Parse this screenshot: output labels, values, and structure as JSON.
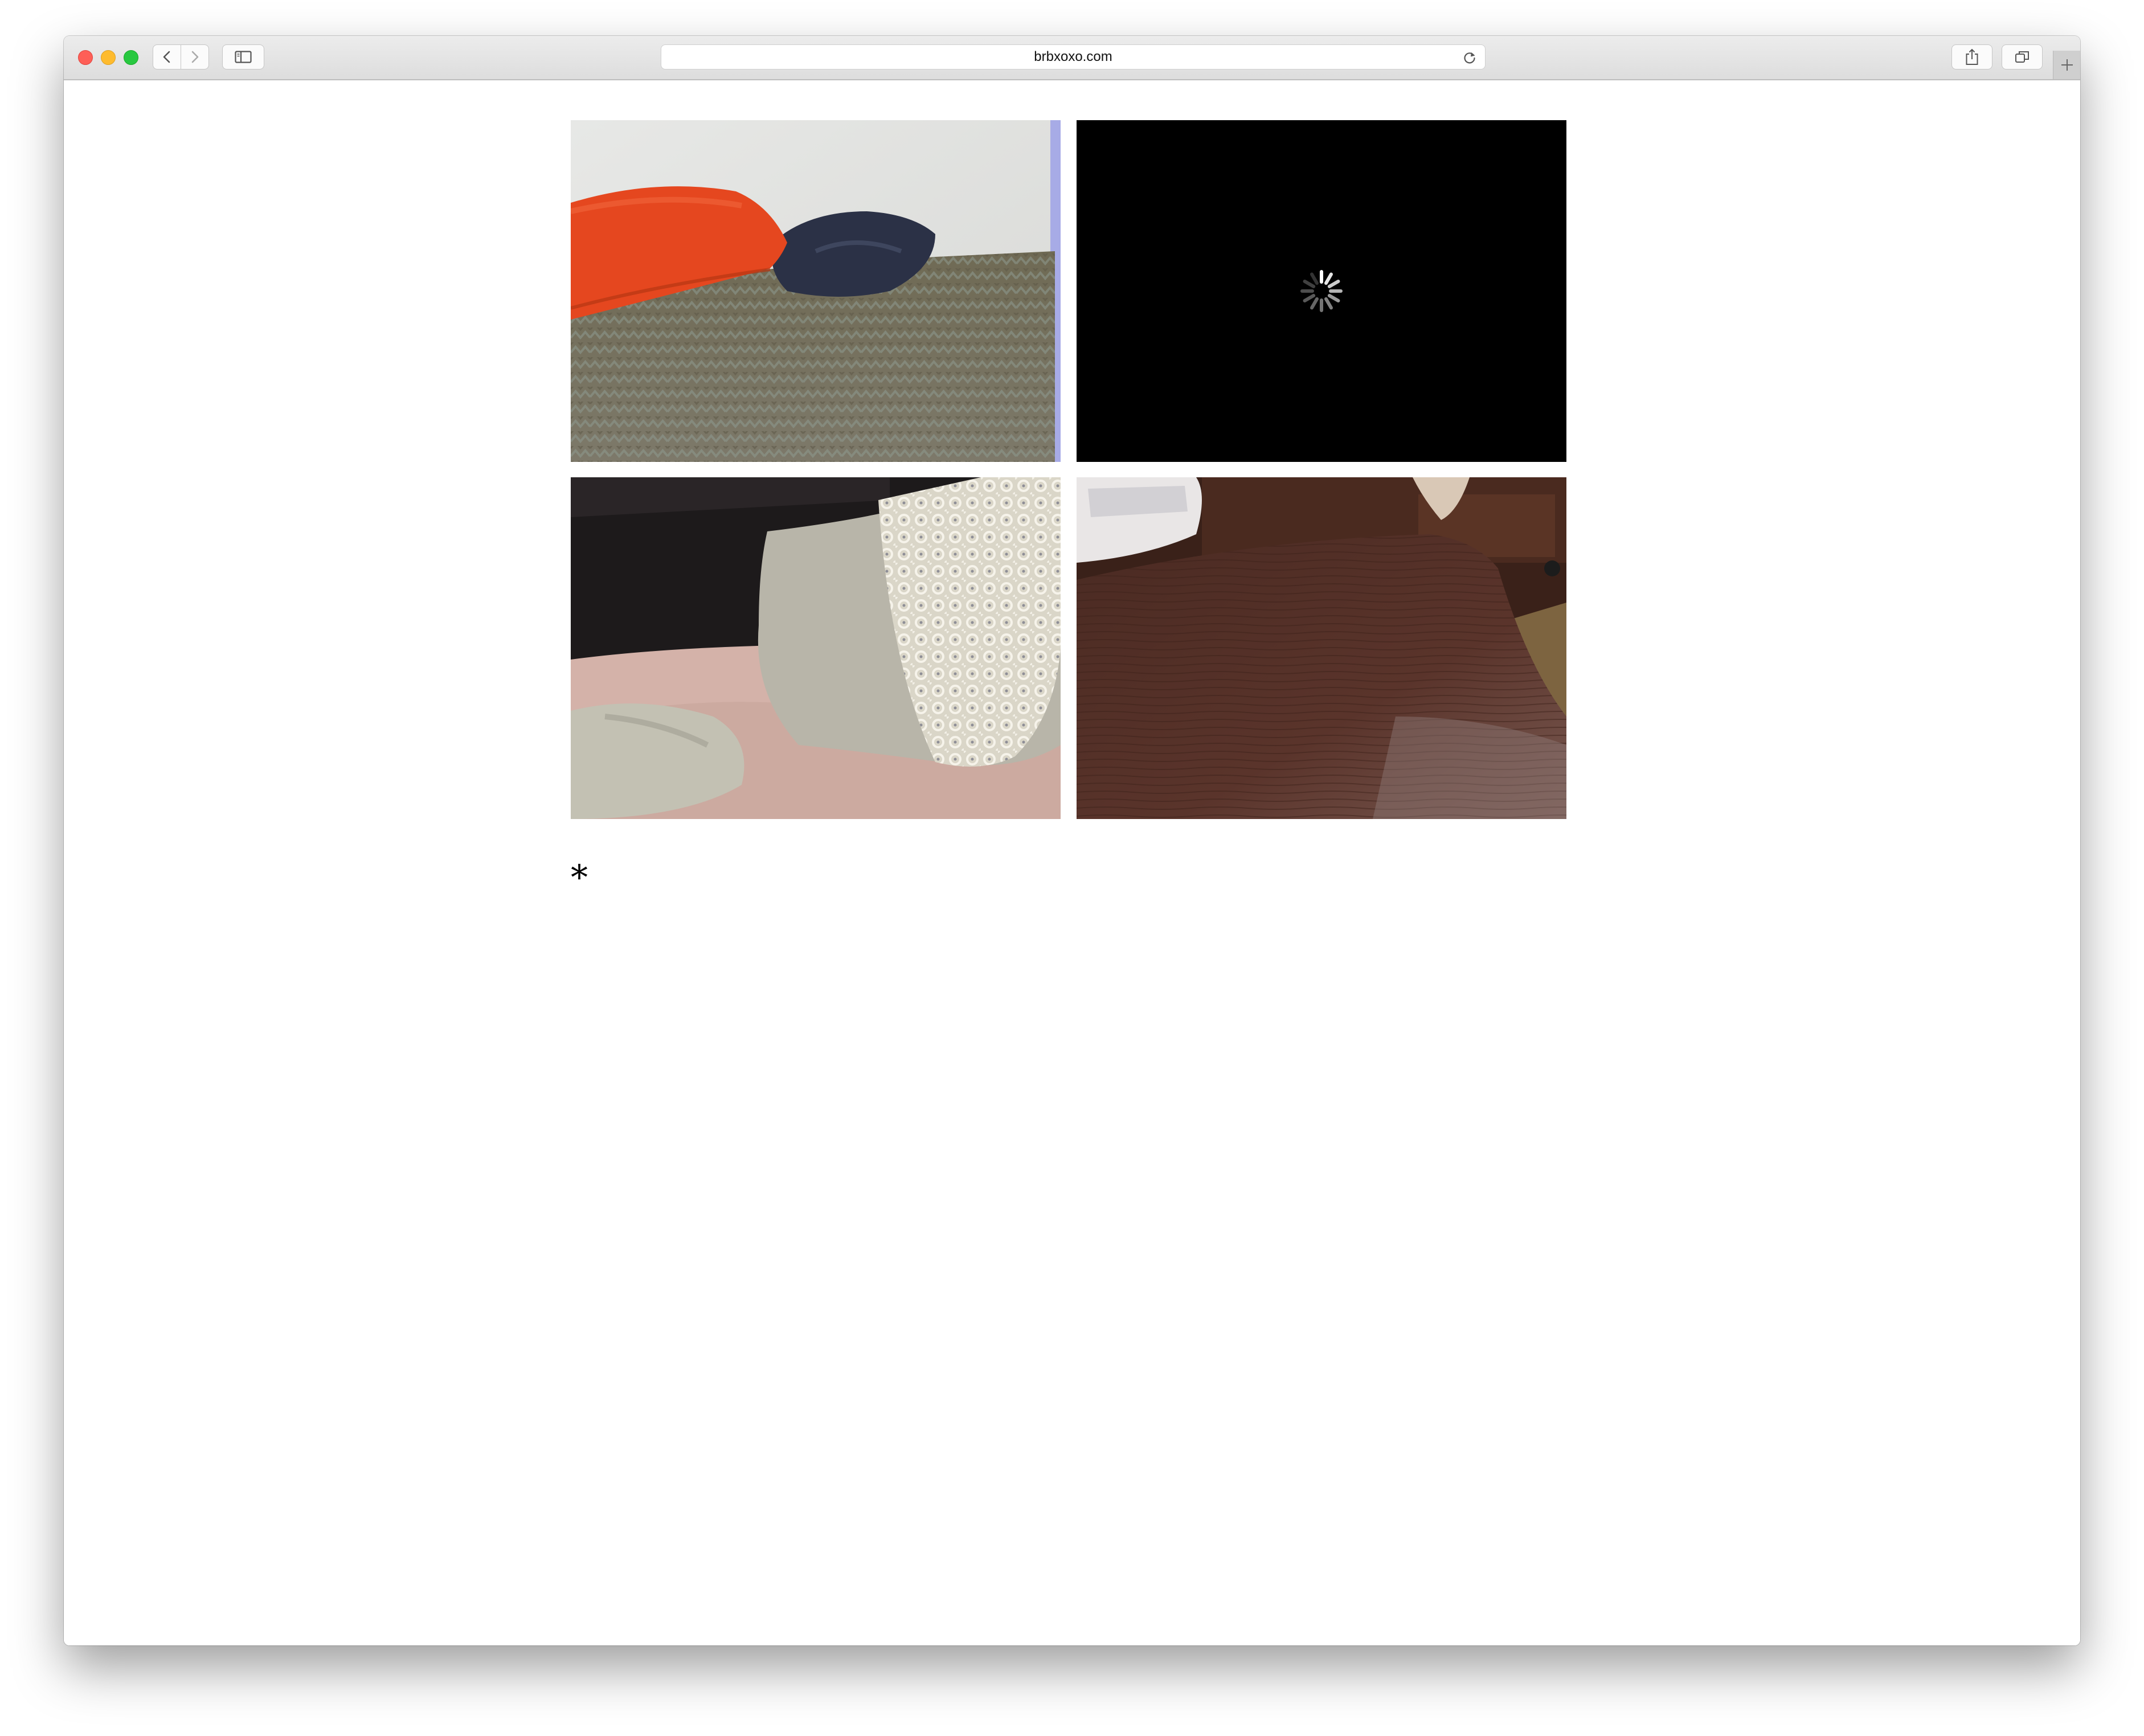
{
  "browser": {
    "url": "brbxoxo.com"
  },
  "page": {
    "footer_mark": "*"
  },
  "tiles": [
    {
      "name": "video-tile-bed-orange-pillow",
      "state": "playing"
    },
    {
      "name": "video-tile-loading",
      "state": "loading"
    },
    {
      "name": "video-tile-lace-pillow",
      "state": "playing"
    },
    {
      "name": "video-tile-wood-table",
      "state": "playing"
    }
  ],
  "colors": {
    "loading_background": "#000000",
    "page_background": "#ffffff"
  },
  "icons": {
    "toolbar": [
      "back-icon",
      "forward-icon",
      "sidebar-icon",
      "reload-icon",
      "share-icon",
      "tabs-overview-icon",
      "new-tab-icon"
    ],
    "loading": "spinner-icon"
  }
}
